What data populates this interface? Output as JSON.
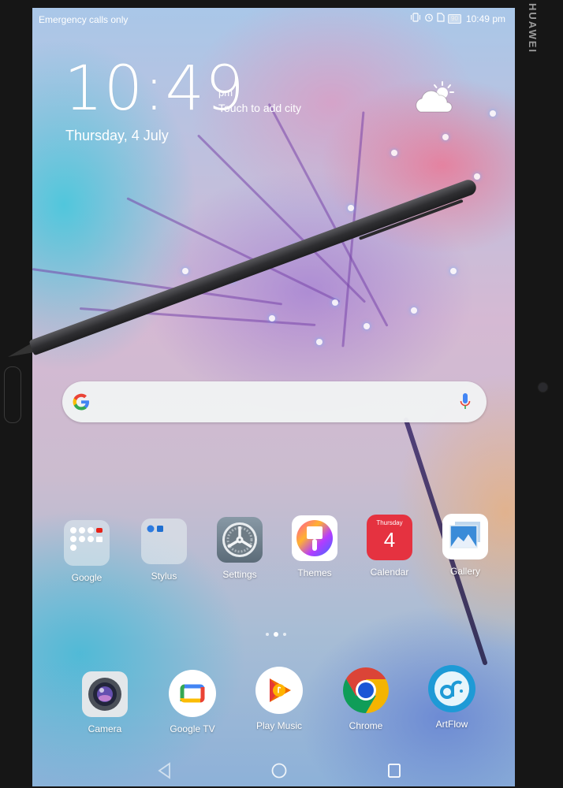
{
  "device": {
    "brand": "HUAWEI"
  },
  "status_bar": {
    "carrier_text": "Emergency calls only",
    "icons": [
      "vibrate-icon",
      "alarm-icon",
      "sim-icon"
    ],
    "battery_level": "90",
    "time": "10:49 pm"
  },
  "lock_clock": {
    "time": "10:49",
    "ampm": "pm",
    "city_prompt": "Touch to add city",
    "date": "Thursday, 4 July",
    "weather_icon": "partly-cloudy-icon"
  },
  "search": {
    "placeholder": "",
    "logo": "google-g-icon",
    "voice": "mic-icon"
  },
  "apps_row": [
    {
      "label": "Google",
      "type": "folder"
    },
    {
      "label": "Stylus",
      "type": "folder"
    },
    {
      "label": "Settings",
      "type": "app"
    },
    {
      "label": "Themes",
      "type": "app"
    },
    {
      "label": "Calendar",
      "type": "app",
      "weekday": "Thursday",
      "day": "4"
    },
    {
      "label": "Gallery",
      "type": "app"
    }
  ],
  "page_indicator": {
    "pages": 3,
    "current": 2
  },
  "dock": [
    {
      "label": "Camera"
    },
    {
      "label": "Google TV"
    },
    {
      "label": "Play Music"
    },
    {
      "label": "Chrome"
    },
    {
      "label": "ArtFlow"
    }
  ],
  "nav_bar": {
    "buttons": [
      "back",
      "home",
      "recents"
    ]
  },
  "colors": {
    "calendar_red": "#e53240",
    "chrome_red": "#db4437",
    "chrome_green": "#0f9d58",
    "chrome_yellow": "#f4b400",
    "chrome_blue": "#1a55d6",
    "artflow_blue": "#1e9ad6"
  }
}
